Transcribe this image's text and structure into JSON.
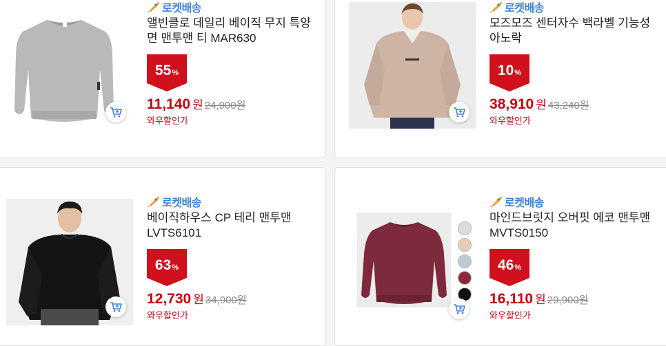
{
  "products": [
    {
      "delivery_label": "로켓배송",
      "title": "앨빈클로 데일리 베이직 무지 특양면 맨투맨 티 MAR630",
      "discount": "55",
      "percent_sign": "%",
      "price": "11,140",
      "won": "원",
      "original_price": "24,900원",
      "deal_label": "와우할인가",
      "image": "gray-sweatshirt"
    },
    {
      "delivery_label": "로켓배송",
      "title": "모즈모즈 센터자수 백라벨 기능성 아노락",
      "discount": "10",
      "percent_sign": "%",
      "price": "38,910",
      "won": "원",
      "original_price": "43,240원",
      "deal_label": "와우할인가",
      "image": "beige-anorak-model"
    },
    {
      "delivery_label": "로켓배송",
      "title": "베이직하우스 CP 테리 맨투맨 LVTS6101",
      "discount": "63",
      "percent_sign": "%",
      "price": "12,730",
      "won": "원",
      "original_price": "34,900원",
      "deal_label": "와우할인가",
      "image": "black-sweatshirt-model"
    },
    {
      "delivery_label": "로켓배송",
      "title": "마인드브릿지 오버핏 에코 맨투맨 MVTS0150",
      "discount": "46",
      "percent_sign": "%",
      "price": "16,110",
      "won": "원",
      "original_price": "29,900원",
      "deal_label": "와우할인가",
      "image": "burgundy-sweatshirt",
      "swatches": [
        "#dcdcdc",
        "#e8cdb6",
        "#b9cad6",
        "#8a2a3a",
        "#111111"
      ]
    }
  ],
  "colors": {
    "rocket_blue": "#3d82d6",
    "price_red": "#c8000f",
    "badge_red": "#d0101c"
  }
}
